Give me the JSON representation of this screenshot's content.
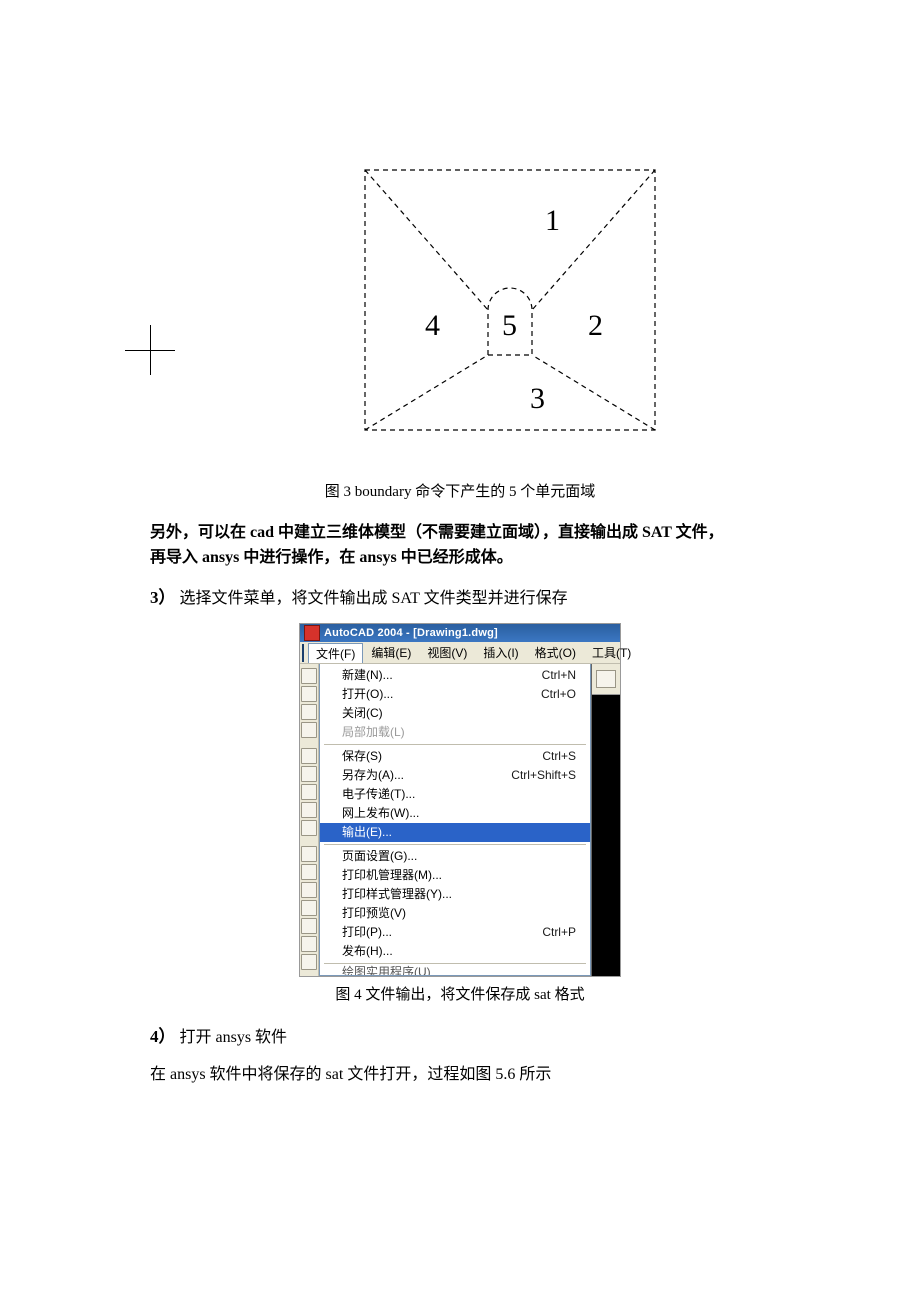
{
  "fig3": {
    "labels": {
      "top": "1",
      "right": "2",
      "bottom": "3",
      "left": "4",
      "center": "5"
    },
    "caption": "图 3 boundary 命令下产生的 5 个单元面域"
  },
  "note_bold_line1": "另外，可以在 cad 中建立三维体模型（不需要建立面域），直接输出成 SAT 文件，",
  "note_bold_line2": "再导入 ansys 中进行操作，在 ansys 中已经形成体。",
  "step3": {
    "num": "3）",
    "text": "选择文件菜单，将文件输出成 SAT 文件类型并进行保存"
  },
  "autocad": {
    "title": "AutoCAD 2004 - [Drawing1.dwg]",
    "menubar": [
      "文件(F)",
      "编辑(E)",
      "视图(V)",
      "插入(I)",
      "格式(O)",
      "工具(T)"
    ],
    "menu": {
      "g1": [
        {
          "label": "新建(N)...",
          "shortcut": "Ctrl+N"
        },
        {
          "label": "打开(O)...",
          "shortcut": "Ctrl+O"
        },
        {
          "label": "关闭(C)",
          "shortcut": ""
        },
        {
          "label": "局部加载(L)",
          "shortcut": "",
          "disabled": true
        }
      ],
      "g2": [
        {
          "label": "保存(S)",
          "shortcut": "Ctrl+S"
        },
        {
          "label": "另存为(A)...",
          "shortcut": "Ctrl+Shift+S"
        },
        {
          "label": "电子传递(T)...",
          "shortcut": ""
        },
        {
          "label": "网上发布(W)...",
          "shortcut": ""
        },
        {
          "label": "输出(E)...",
          "shortcut": "",
          "highlight": true
        }
      ],
      "g3": [
        {
          "label": "页面设置(G)...",
          "shortcut": ""
        },
        {
          "label": "打印机管理器(M)...",
          "shortcut": ""
        },
        {
          "label": "打印样式管理器(Y)...",
          "shortcut": ""
        },
        {
          "label": "打印预览(V)",
          "shortcut": ""
        },
        {
          "label": "打印(P)...",
          "shortcut": "Ctrl+P"
        },
        {
          "label": "发布(H)...",
          "shortcut": ""
        }
      ],
      "cut": "绘图实用程序(U)"
    }
  },
  "fig4_caption": "图 4 文件输出，将文件保存成 sat 格式",
  "step4": {
    "num": "4）",
    "text": "打开 ansys 软件"
  },
  "para_after": "在 ansys 软件中将保存的 sat 文件打开，过程如图 5.6 所示"
}
